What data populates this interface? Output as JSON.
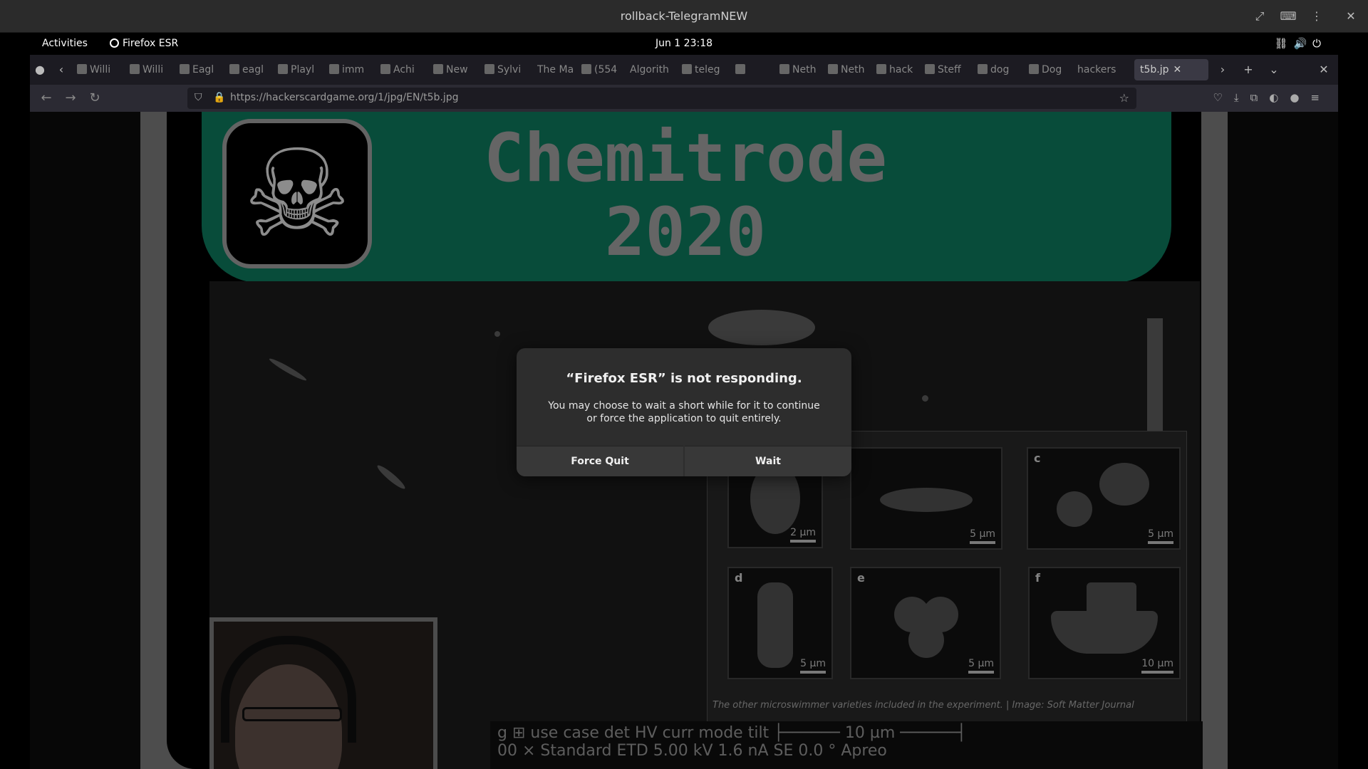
{
  "window": {
    "title": "rollback-TelegramNEW",
    "buttons": [
      "expand-icon",
      "keyboard-icon",
      "menu-icon",
      "close-icon"
    ]
  },
  "top_bar": {
    "activities": "Activities",
    "app_name": "Firefox ESR",
    "clock": "Jun 1  23:18"
  },
  "tabs": [
    {
      "label": "Willi",
      "icon": "wikipedia-icon"
    },
    {
      "label": "Willi",
      "icon": "wikipedia-icon"
    },
    {
      "label": "Eagl",
      "icon": "wikipedia-icon"
    },
    {
      "label": "eagl",
      "icon": "google-icon"
    },
    {
      "label": "Playl",
      "icon": "page-icon"
    },
    {
      "label": "imm",
      "icon": "google-icon"
    },
    {
      "label": "Achi",
      "icon": "page-icon"
    },
    {
      "label": "New",
      "icon": "firefox-icon"
    },
    {
      "label": "Sylvi",
      "icon": "page-icon"
    },
    {
      "label": "The Ma",
      "icon": ""
    },
    {
      "label": "(554",
      "icon": "youtube-icon"
    },
    {
      "label": "Algorith",
      "icon": ""
    },
    {
      "label": "teleg",
      "icon": "google-icon"
    },
    {
      "label": "",
      "icon": "page-icon"
    },
    {
      "label": "Neth",
      "icon": "page-icon"
    },
    {
      "label": "Neth",
      "icon": "page-icon"
    },
    {
      "label": "hack",
      "icon": "github-icon"
    },
    {
      "label": "Steff",
      "icon": "page-icon"
    },
    {
      "label": "dog",
      "icon": "google-icon"
    },
    {
      "label": "Dog",
      "icon": "page-icon"
    },
    {
      "label": "hackers",
      "icon": ""
    },
    {
      "label": "t5b.jp",
      "icon": "",
      "active": true
    }
  ],
  "address_bar": {
    "url": "https://hackerscardgame.org/1/jpg/EN/t5b.jpg"
  },
  "card": {
    "title_line1": "Chemitrode",
    "title_line2": "2020",
    "panels": [
      {
        "label": "",
        "scale": "2 µm"
      },
      {
        "label": "",
        "scale": "5 µm"
      },
      {
        "label": "c",
        "scale": "5 µm"
      },
      {
        "label": "d",
        "scale": "5 µm"
      },
      {
        "label": "e",
        "scale": "5 µm"
      },
      {
        "label": "f",
        "scale": "10 µm"
      }
    ],
    "caption": "The other microswimmer varieties included in the experiment.  | Image: Soft Matter Journal",
    "sem_footer_line1": "g  ⊞ use case   det   HV      curr     mode  tilt          ├────── 10 µm ──────┤",
    "sem_footer_line2": "00 ×  Standard  ETD  5.00 kV  1.6 nA  SE     0.0 °                Apreo"
  },
  "dialog": {
    "title": "“Firefox ESR” is not responding.",
    "body": "You may choose to wait a short while for it to continue or force the application to quit entirely.",
    "force_quit": "Force Quit",
    "wait": "Wait"
  }
}
